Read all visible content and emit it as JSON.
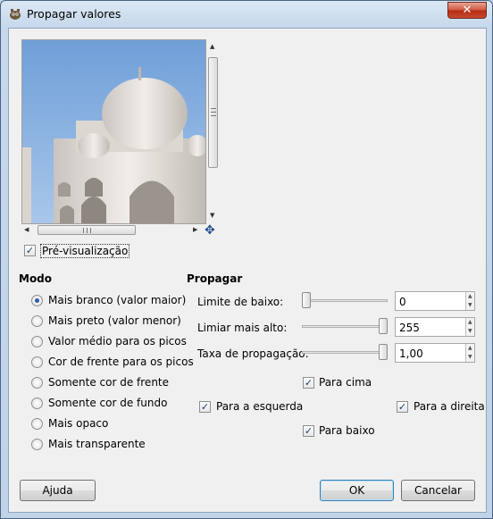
{
  "window": {
    "title": "Propagar valores",
    "close_label": "✕"
  },
  "preview": {
    "checkbox_label": "Pré-visualização",
    "checked": true
  },
  "mode": {
    "heading": "Modo",
    "options": [
      {
        "label": "Mais branco (valor maior)",
        "selected": true
      },
      {
        "label": "Mais preto (valor menor)",
        "selected": false
      },
      {
        "label": "Valor médio para os picos",
        "selected": false
      },
      {
        "label": "Cor de frente para os picos",
        "selected": false
      },
      {
        "label": "Somente cor de frente",
        "selected": false
      },
      {
        "label": "Somente cor de fundo",
        "selected": false
      },
      {
        "label": "Mais opaco",
        "selected": false
      },
      {
        "label": "Mais transparente",
        "selected": false
      }
    ]
  },
  "propagate": {
    "heading": "Propagar",
    "lower_limit": {
      "label": "Limite de baixo:",
      "value": "0",
      "fraction": 0.0
    },
    "upper_limit": {
      "label": "Limiar mais alto:",
      "value": "255",
      "fraction": 1.0
    },
    "rate": {
      "label": "Taxa de propagação:",
      "value": "1,00",
      "fraction": 1.0
    },
    "up": {
      "label": "Para cima",
      "checked": true
    },
    "left": {
      "label": "Para a esquerda",
      "checked": true
    },
    "right": {
      "label": "Para a direita",
      "checked": true
    },
    "down": {
      "label": "Para baixo",
      "checked": true
    }
  },
  "buttons": {
    "help": "Ajuda",
    "ok": "OK",
    "cancel": "Cancelar"
  },
  "icons": {
    "app": "gimp-icon",
    "navigate": "navigate-icon"
  }
}
